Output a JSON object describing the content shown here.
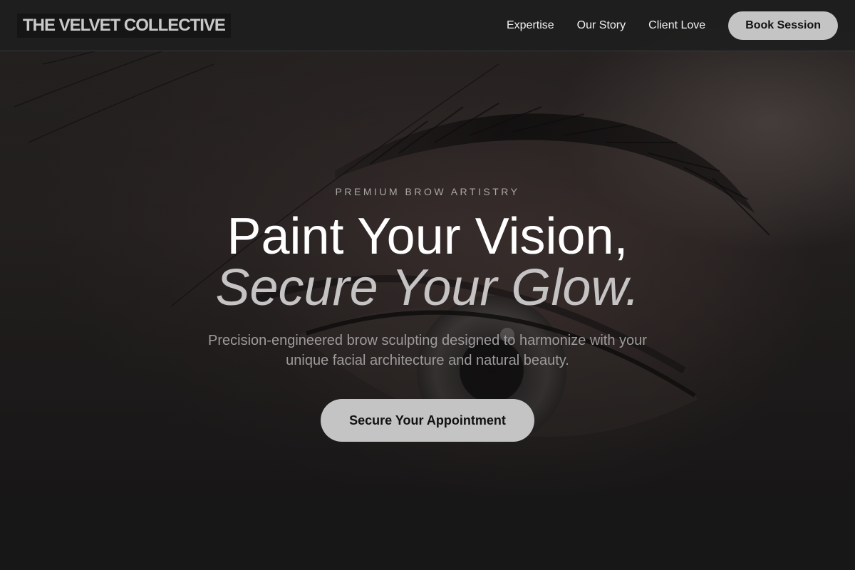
{
  "header": {
    "logo": "THE VELVET COLLECTIVE",
    "nav": [
      "Expertise",
      "Our Story",
      "Client Love"
    ],
    "book_label": "Book Session"
  },
  "hero": {
    "eyebrow": "PREMIUM BROW ARTISTRY",
    "headline_line1": "Paint Your Vision,",
    "headline_line2": "Secure Your Glow.",
    "subtext": "Precision-engineered brow sculpting designed to harmonize with your unique facial architecture and natural beauty.",
    "cta_label": "Secure Your Appointment"
  },
  "colors": {
    "background": "#1c1b1b",
    "button_fill": "#c4c4c4",
    "headline_primary": "#ffffff",
    "headline_secondary": "#c5c3c3"
  }
}
